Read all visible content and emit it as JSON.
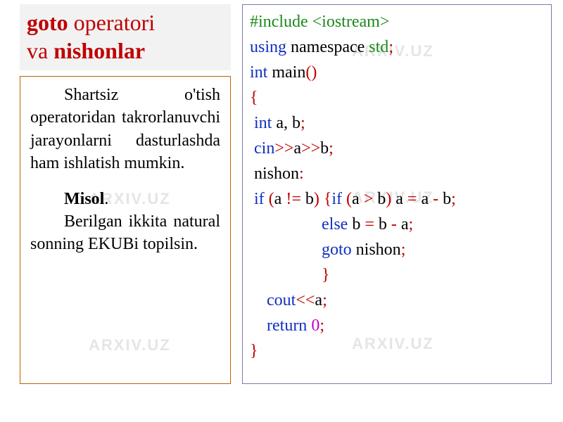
{
  "watermark_text": "ARXIV.UZ",
  "title": {
    "part1_bold": "goto",
    "part1_rest": " operatori",
    "part2_pre": "va ",
    "part2_bold": "nishonlar"
  },
  "description": {
    "para1": "Shartsiz o'tish operatoridan takrorlanuvchi jarayonlarni dasturlashda ham ishlatish mumkin.",
    "misol_label": "Misol",
    "misol_dot": ".",
    "para2": "Berilgan ikkita natural sonning EKUBi topilsin."
  },
  "code": {
    "l1_include": "#include <iostream>",
    "l2_using": "using",
    "l2_namespace": " namespace ",
    "l2_std": "std",
    "l2_semi": ";",
    "l3_int": "int",
    "l3_main": " main",
    "l3_parens": "()",
    "l4_brace": "{",
    "l5_int": " int",
    "l5_ab": " a, b",
    "l5_semi": ";",
    "l6_cin": " cin",
    "l6_op1": ">>",
    "l6_a": "a",
    "l6_op2": ">>",
    "l6_b": "b",
    "l6_semi": ";",
    "l7_label": " nishon",
    "l7_colon": ":",
    "l8_if1": " if ",
    "l8_p1": "(",
    "l8_a1": "a ",
    "l8_neq": "!=",
    "l8_b1": " b",
    "l8_p2": ") {",
    "l8_if2": "if ",
    "l8_p3": "(",
    "l8_a2": "a ",
    "l8_gt": ">",
    "l8_b2": " b",
    "l8_p4": ") ",
    "l8_a3": "a ",
    "l8_eq1": "=",
    "l8_a4": " a ",
    "l8_minus1": "-",
    "l8_b3": " b",
    "l8_semi1": ";",
    "l9_pad": "                 ",
    "l9_else": "else ",
    "l9_b1": "b ",
    "l9_eq": "=",
    "l9_b2": " b ",
    "l9_minus": "-",
    "l9_a1": " a",
    "l9_semi": ";",
    "l10_pad": "                 ",
    "l10_goto": "goto ",
    "l10_nishon": "nishon",
    "l10_semi": ";",
    "l11_pad": "                 ",
    "l11_brace": "}",
    "l12_cout": "    cout",
    "l12_op": "<<",
    "l12_a": "a",
    "l12_semi": ";",
    "l13_return": "    return ",
    "l13_zero": "0",
    "l13_semi": ";",
    "l14_brace": "}"
  }
}
